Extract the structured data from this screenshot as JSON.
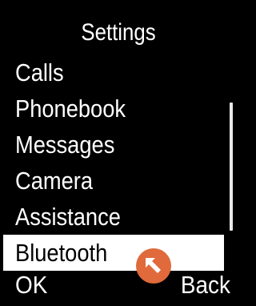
{
  "screen": {
    "title": "Settings"
  },
  "menu": {
    "items": [
      {
        "label": "Calls"
      },
      {
        "label": "Phonebook"
      },
      {
        "label": "Messages"
      },
      {
        "label": "Camera"
      },
      {
        "label": "Assistance"
      },
      {
        "label": "Bluetooth"
      }
    ],
    "selected": "Bluetooth"
  },
  "softkeys": {
    "left": "OK",
    "right": "Back"
  },
  "cursor": {
    "icon": "arrow-up-left-icon",
    "color": "#e06a3b"
  },
  "colors": {
    "background": "#000000",
    "text": "#ffffff",
    "selection": "#ffffff"
  }
}
